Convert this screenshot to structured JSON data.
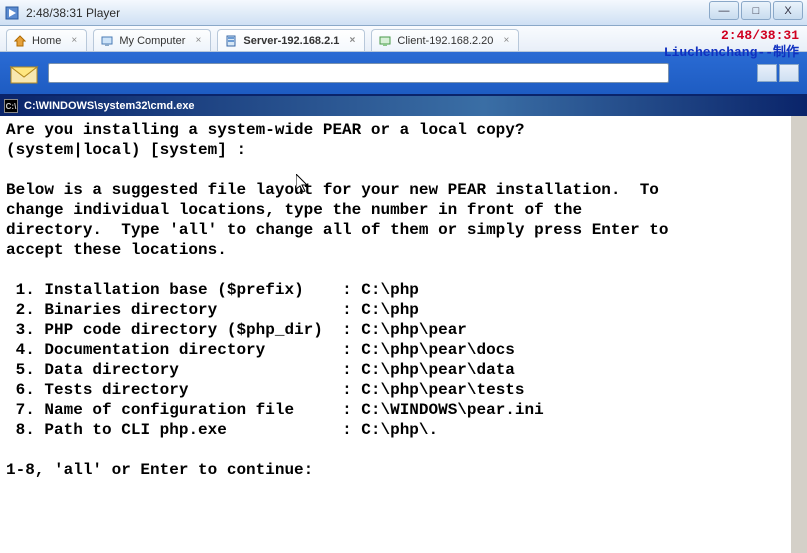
{
  "window": {
    "title": "2:48/38:31 Player",
    "buttons": {
      "min": "—",
      "max": "□",
      "close": "X"
    }
  },
  "overlay": {
    "time": "2:48/38:31",
    "author": "Liuchenchang--制作"
  },
  "tabs": [
    {
      "label": "Home",
      "icon": "home-icon",
      "active": false
    },
    {
      "label": "My Computer",
      "icon": "computer-icon",
      "active": false
    },
    {
      "label": "Server-192.168.2.1",
      "icon": "server-icon",
      "active": true
    },
    {
      "label": "Client-192.168.2.20",
      "icon": "client-icon",
      "active": false
    }
  ],
  "cmd": {
    "title": "C:\\WINDOWS\\system32\\cmd.exe",
    "question": "Are you installing a system-wide PEAR or a local copy?",
    "prompt_opts": "(system|local) [system] :",
    "para1": "Below is a suggested file layout for your new PEAR installation.  To",
    "para2": "change individual locations, type the number in front of the",
    "para3": "directory.  Type 'all' to change all of them or simply press Enter to",
    "para4": "accept these locations.",
    "rows": [
      {
        "n": "1",
        "label": "Installation base ($prefix)   ",
        "value": "C:\\php"
      },
      {
        "n": "2",
        "label": "Binaries directory            ",
        "value": "C:\\php"
      },
      {
        "n": "3",
        "label": "PHP code directory ($php_dir) ",
        "value": "C:\\php\\pear"
      },
      {
        "n": "4",
        "label": "Documentation directory       ",
        "value": "C:\\php\\pear\\docs"
      },
      {
        "n": "5",
        "label": "Data directory                ",
        "value": "C:\\php\\pear\\data"
      },
      {
        "n": "6",
        "label": "Tests directory               ",
        "value": "C:\\php\\pear\\tests"
      },
      {
        "n": "7",
        "label": "Name of configuration file    ",
        "value": "C:\\WINDOWS\\pear.ini"
      },
      {
        "n": "8",
        "label": "Path to CLI php.exe           ",
        "value": "C:\\php\\."
      }
    ],
    "footer": "1-8, 'all' or Enter to continue:"
  }
}
